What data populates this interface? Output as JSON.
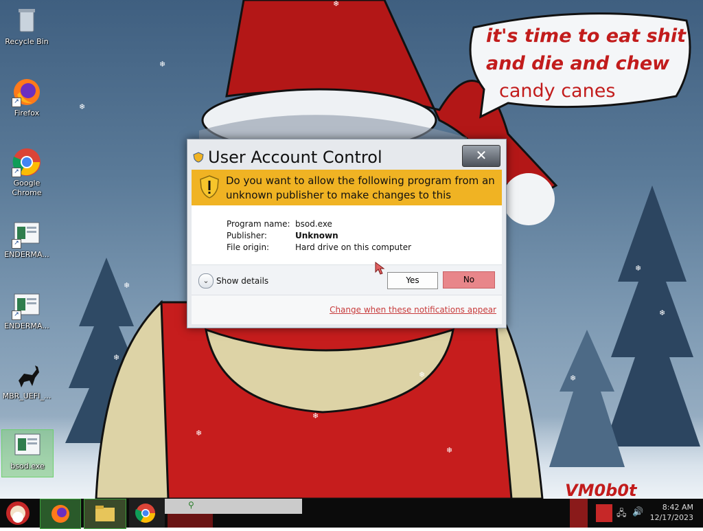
{
  "desktop": {
    "speech_bubble": {
      "line1": "it's time to eat shit",
      "line2": "and die and chew",
      "line3": "candy canes"
    },
    "watermark": "VM0b0t",
    "icons": [
      {
        "label": "Recycle Bin",
        "icon": "recycle-bin-icon"
      },
      {
        "label": "Firefox",
        "icon": "firefox-icon"
      },
      {
        "label": "Google Chrome",
        "icon": "chrome-icon"
      },
      {
        "label": "ENDERMA...",
        "icon": "program-icon"
      },
      {
        "label": "ENDERMA...",
        "icon": "program-icon"
      },
      {
        "label": "MBR_UEFI_...",
        "icon": "deer-icon"
      },
      {
        "label": "bsod.exe",
        "icon": "program-icon"
      }
    ]
  },
  "uac": {
    "title": "User Account Control",
    "close_label": "✕",
    "question": "Do you want to allow the following program from an unknown publisher to make changes to this computer?",
    "fields": [
      {
        "label": "Program name:",
        "value": "bsod.exe"
      },
      {
        "label": "Publisher:",
        "value": "Unknown"
      },
      {
        "label": "File origin:",
        "value": "Hard drive on this computer"
      }
    ],
    "show_details": "Show details",
    "yes_label": "Yes",
    "no_label": "No",
    "change_link": "Change when these notifications appear"
  },
  "taskbar": {
    "time": "8:42 AM",
    "date": "12/17/2023"
  },
  "colors": {
    "banner": "#f0b323",
    "no_button": "#e8868a",
    "link": "#c73a3a",
    "speech_text": "#c21c1c"
  }
}
